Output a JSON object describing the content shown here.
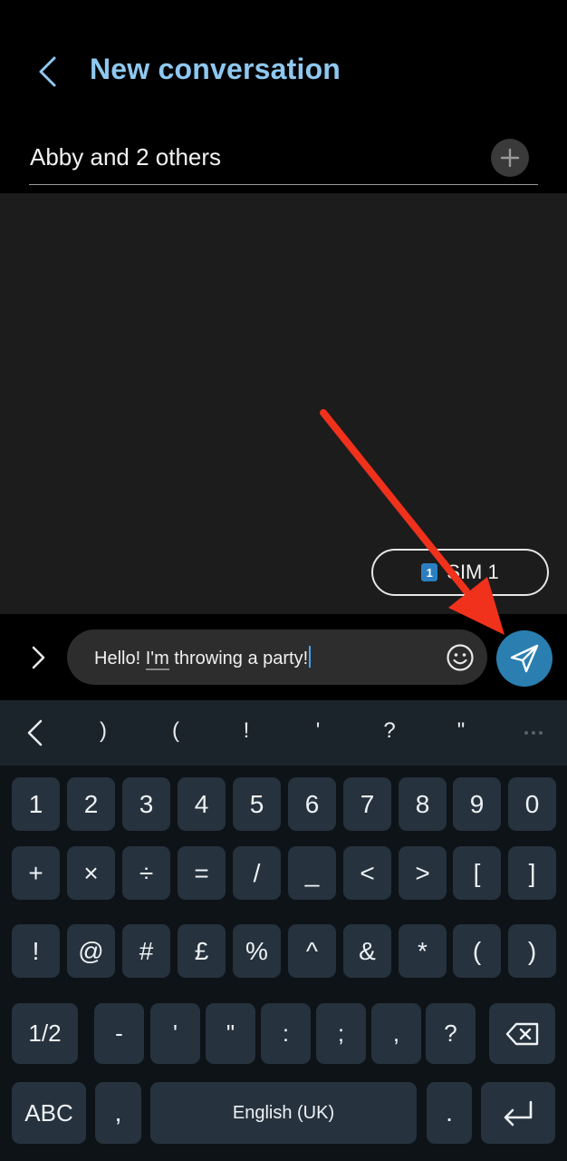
{
  "header": {
    "title": "New conversation",
    "recipient": "Abby and 2 others"
  },
  "conversation": {
    "sim_chip": {
      "badge": "1",
      "label": "SIM 1"
    }
  },
  "compose": {
    "message_part1": "Hello! ",
    "message_underlined": "I'm",
    "message_part2": " throwing a party!"
  },
  "keyboard": {
    "suggestions": [
      ")",
      "(",
      "!",
      "'",
      "?",
      "\""
    ],
    "row1": [
      "1",
      "2",
      "3",
      "4",
      "5",
      "6",
      "7",
      "8",
      "9",
      "0"
    ],
    "row2": [
      "+",
      "×",
      "÷",
      "=",
      "/",
      "_",
      "<",
      ">",
      "[",
      "]"
    ],
    "row3": [
      "!",
      "@",
      "#",
      "£",
      "%",
      "^",
      "&",
      "*",
      "(",
      ")"
    ],
    "row4": [
      "-",
      "'",
      "\"",
      ":",
      ";",
      ",",
      "?"
    ],
    "page_toggle": "1/2",
    "abc": "ABC",
    "comma": ",",
    "space": "English (UK)",
    "period": "."
  },
  "colors": {
    "accent": "#8ec8f0",
    "send_button": "#2a7fb0",
    "annotation_arrow": "#f0311c"
  },
  "icons": {
    "back": "chevron-left-icon",
    "add": "plus-icon",
    "expand": "chevron-right-icon",
    "emoji": "smiley-icon",
    "send": "paper-plane-icon",
    "backspace": "backspace-icon",
    "enter": "enter-icon"
  }
}
